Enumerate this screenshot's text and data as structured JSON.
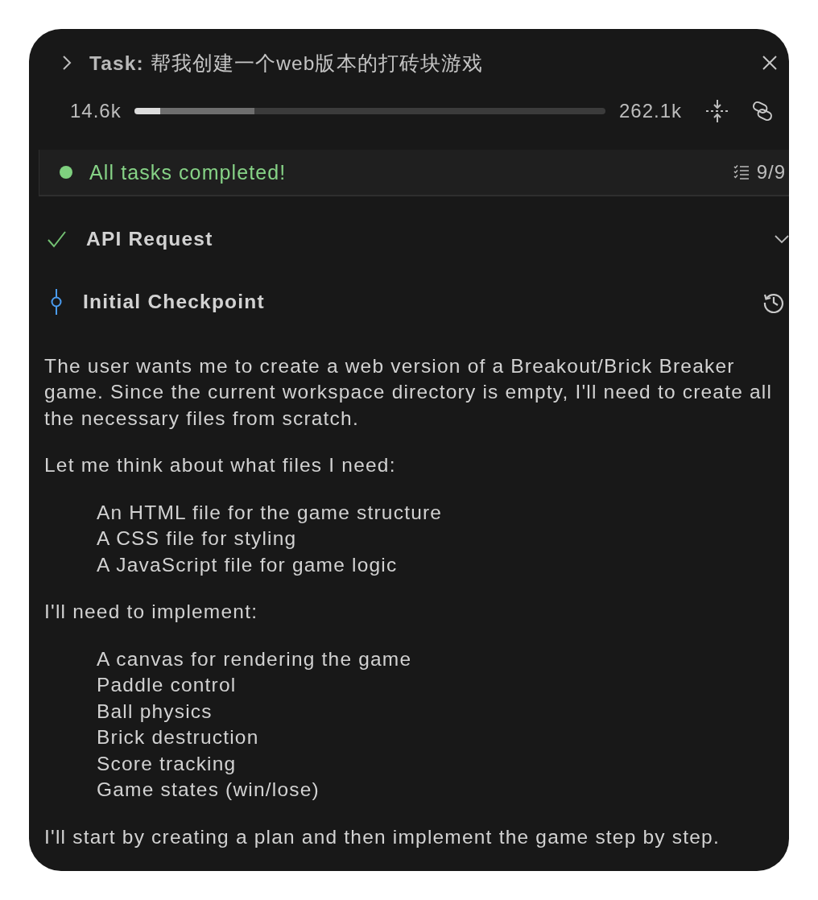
{
  "task": {
    "title": "**Task:** 帮我创建一个web版本的打砖块游戏",
    "expanded": false
  },
  "context": {
    "used": "14.6k",
    "limit": "262.1k",
    "segments": [
      {
        "kind": "used",
        "level": 0.055
      },
      {
        "kind": "reserved",
        "level": 0.2
      }
    ]
  },
  "status": {
    "message": "All tasks completed!",
    "completed": true,
    "progress": "9/9"
  },
  "steps": [
    {
      "kind": "api_request",
      "label": "API Request",
      "done": true
    },
    {
      "kind": "checkpoint",
      "label": "Initial Checkpoint"
    }
  ],
  "content": [
    {
      "kind": "paragraph",
      "text": "The user wants me to create a web version of a Breakout/Brick Breaker game. Since the current workspace directory is empty, I'll need to create all the necessary files from scratch."
    },
    {
      "kind": "paragraph",
      "text": "Let me think about what files I need:"
    },
    {
      "kind": "list",
      "items": [
        "An HTML file for the game structure",
        "A CSS file for styling",
        "A JavaScript file for game logic"
      ]
    },
    {
      "kind": "paragraph",
      "text": "I'll need to implement:"
    },
    {
      "kind": "list",
      "items": [
        "A canvas for rendering the game",
        "Paddle control",
        "Ball physics",
        "Brick destruction",
        "Score tracking",
        "Game states (win/lose)"
      ]
    },
    {
      "kind": "paragraph",
      "text": "I'll start by creating a plan and then implement the game step by step."
    }
  ]
}
